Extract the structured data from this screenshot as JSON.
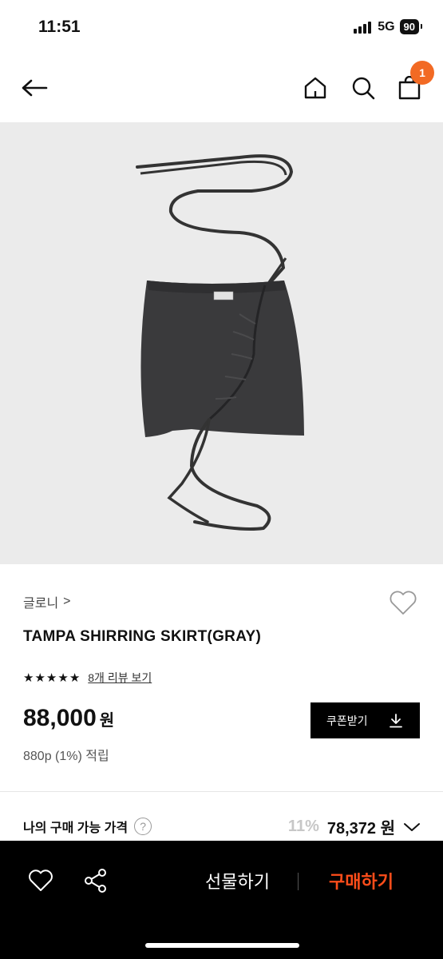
{
  "status_bar": {
    "time": "11:51",
    "network": "5G",
    "battery": "90"
  },
  "nav": {
    "icons": [
      "back-arrow-icon",
      "home-icon",
      "search-icon",
      "shopping-bag-icon"
    ],
    "cart_count": "1",
    "badge_color": "#f26a24"
  },
  "product": {
    "image_alt": "gray shirring mini skirt with drawstring ties",
    "brand": "글로니",
    "brand_chevron": ">",
    "title": "TAMPA SHIRRING SKIRT(GRAY)",
    "rating_stars": 5,
    "review_link": "8개 리뷰 보기",
    "price": "88,000",
    "price_unit": "원",
    "points": "880p (1%) 적립",
    "coupon_label": "쿠폰받기"
  },
  "my_price": {
    "label": "나의 구매 가능 가격",
    "help": "?",
    "discount_rate": "11%",
    "price": "78,372",
    "unit": "원"
  },
  "bottom_bar": {
    "gift_label": "선물하기",
    "buy_label": "구매하기",
    "buy_color": "#ff4d1a"
  }
}
